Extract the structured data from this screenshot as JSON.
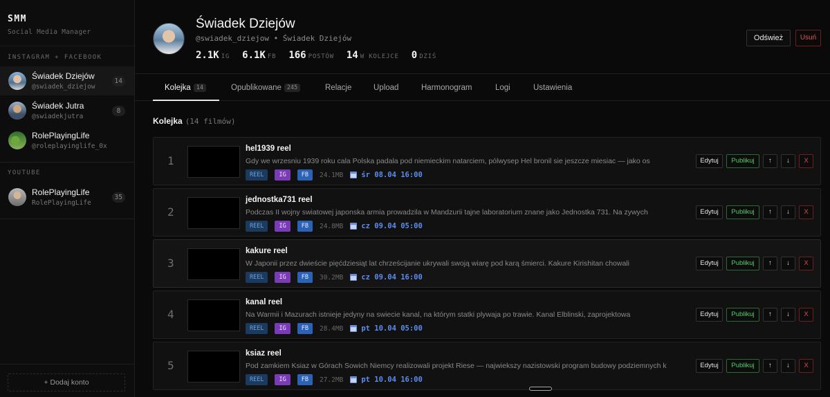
{
  "sidebar": {
    "brand_title": "SMM",
    "brand_subtitle": "Social Media Manager",
    "section_ig": "INSTAGRAM + FACEBOOK",
    "section_yt": "YOUTUBE",
    "accounts_ig": [
      {
        "name": "Świadek Dziejów",
        "handle": "@swiadek_dziejow",
        "count": "14"
      },
      {
        "name": "Świadek Jutra",
        "handle": "@swiadekjutra",
        "count": "8"
      },
      {
        "name": "RolePlayingLife",
        "handle": "@roleplayinglife_0x",
        "count": ""
      }
    ],
    "accounts_yt": [
      {
        "name": "RolePlayingLife",
        "handle": "RolePlayingLife",
        "count": "35"
      }
    ],
    "add_account_label": "+ Dodaj konto"
  },
  "header": {
    "title": "Świadek Dziejów",
    "subtitle": "@swiadek_dziejow • Świadek Dziejów",
    "stats": [
      {
        "value": "2.1K",
        "label": "IG"
      },
      {
        "value": "6.1K",
        "label": "FB"
      },
      {
        "value": "166",
        "label": "POSTÓW"
      },
      {
        "value": "14",
        "label": "W KOLEJCE"
      },
      {
        "value": "0",
        "label": "DZIŚ"
      }
    ],
    "refresh_label": "Odśwież",
    "remove_label": "Usuń"
  },
  "tabs": [
    {
      "label": "Kolejka",
      "count": "14"
    },
    {
      "label": "Opublikowane",
      "count": "245"
    },
    {
      "label": "Relacje",
      "count": ""
    },
    {
      "label": "Upload",
      "count": ""
    },
    {
      "label": "Harmonogram",
      "count": ""
    },
    {
      "label": "Logi",
      "count": ""
    },
    {
      "label": "Ustawienia",
      "count": ""
    }
  ],
  "queue": {
    "title": "Kolejka",
    "subtitle": "(14 filmów)",
    "actions": {
      "edit": "Edytuj",
      "publish": "Publikuj",
      "up": "↑",
      "down": "↓",
      "delete": "X"
    },
    "items": [
      {
        "num": "1",
        "title": "hel1939 reel",
        "desc": "Gdy we wrzesniu 1939 roku cala Polska padala pod niemieckim natarciem, pólwysep Hel bronil sie jeszcze miesiac — jako os",
        "type": "REEL",
        "ig": "IG",
        "fb": "FB",
        "size": "24.1MB",
        "date": "śr 08.04 16:00"
      },
      {
        "num": "2",
        "title": "jednostka731 reel",
        "desc": "Podczas II wojny swiatowej japonska armia prowadzila w Mandzurii tajne laboratorium znane jako Jednostka 731. Na zywych",
        "type": "REEL",
        "ig": "IG",
        "fb": "FB",
        "size": "24.8MB",
        "date": "cz 09.04 05:00"
      },
      {
        "num": "3",
        "title": "kakure reel",
        "desc": "W Japonii przez dwieście pięćdziesiąt lat chrześcijanie ukrywali swoją wiarę pod karą śmierci. Kakure Kirishitan chowali",
        "type": "REEL",
        "ig": "IG",
        "fb": "FB",
        "size": "30.2MB",
        "date": "cz 09.04 16:00"
      },
      {
        "num": "4",
        "title": "kanal reel",
        "desc": "Na Warmii i Mazurach istnieje jedyny na swiecie kanal, na którym statki plywaja po trawie. Kanal Elblinski, zaprojektowa",
        "type": "REEL",
        "ig": "IG",
        "fb": "FB",
        "size": "28.4MB",
        "date": "pt 10.04 05:00"
      },
      {
        "num": "5",
        "title": "ksiaz reel",
        "desc": "Pod zamkiem Ksiaz w Górach Sowich Niemcy realizowali projekt Riese — najwiekszy nazistowski program budowy podziemnych k",
        "type": "REEL",
        "ig": "IG",
        "fb": "FB",
        "size": "27.2MB",
        "date": "pt 10.04 16:00"
      }
    ]
  }
}
